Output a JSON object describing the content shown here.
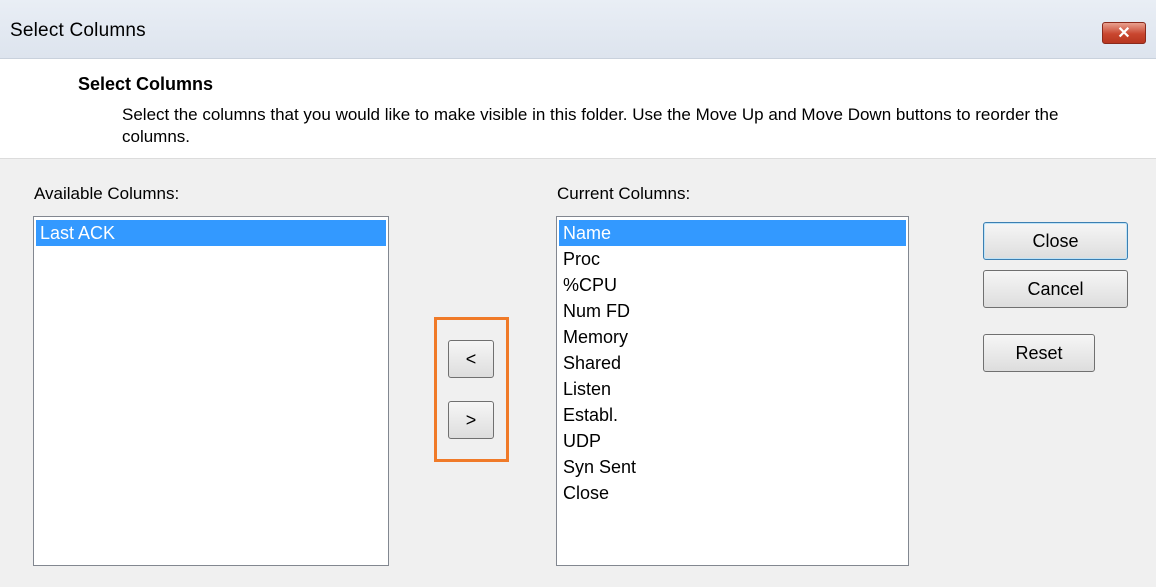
{
  "window": {
    "title": "Select Columns",
    "close_glyph": "✕"
  },
  "header": {
    "title": "Select Columns",
    "description": "Select the columns that you would like to make visible in this folder. Use the Move Up and Move Down buttons to reorder the columns."
  },
  "available": {
    "label": "Available Columns:",
    "items": [
      "Last ACK"
    ],
    "selected": "Last ACK"
  },
  "current": {
    "label": "Current Columns:",
    "items": [
      "Name",
      "Proc",
      "%CPU",
      "Num FD",
      "Memory",
      "Shared",
      "Listen",
      "Establ.",
      "UDP",
      "Syn Sent",
      "Close"
    ],
    "selected": "Name"
  },
  "move_buttons": {
    "remove_label": "<",
    "add_label": ">"
  },
  "actions": {
    "close_label": "Close",
    "cancel_label": "Cancel",
    "reset_label": "Reset"
  },
  "colors": {
    "selection": "#3399ff",
    "highlight": "#f07a28"
  }
}
